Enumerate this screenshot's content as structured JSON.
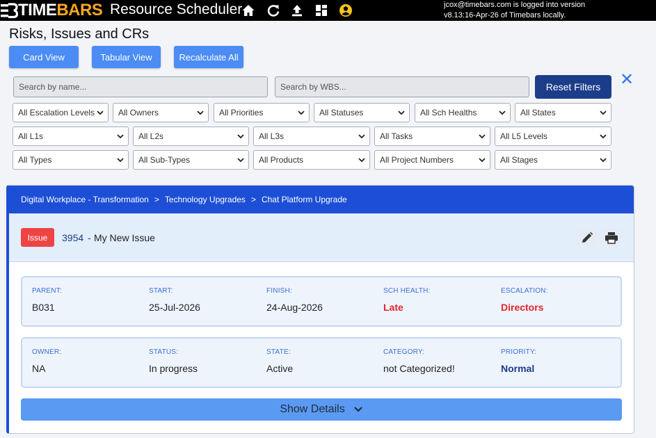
{
  "app": {
    "logo_time": "TIME",
    "logo_bars": "BARS",
    "name": "Resource Scheduler",
    "login_line1": "jcox@timebars.com is logged into version",
    "login_line2": "v8.13:16-Apr-26 of Timebars locally."
  },
  "nav_icons": [
    "home-icon",
    "refresh-icon",
    "upload-icon",
    "dashboard-icon",
    "user-icon"
  ],
  "page": {
    "title": "Risks, Issues and CRs"
  },
  "view_buttons": {
    "card": "Card View",
    "tabular": "Tabular View",
    "recalc": "Recalculate All"
  },
  "search": {
    "name_placeholder": "Search by name...",
    "wbs_placeholder": "Search by WBS...",
    "reset_label": "Reset Filters",
    "close_glyph": "✕"
  },
  "filters": {
    "row1": [
      "All Escalation Levels",
      "All Owners",
      "All Priorities",
      "All Statuses",
      "All Sch Healths",
      "All States"
    ],
    "row2": [
      "All L1s",
      "All L2s",
      "All L3s",
      "All Tasks",
      "All L5 Levels"
    ],
    "row3": [
      "All Types",
      "All Sub-Types",
      "All Products",
      "All Project Numbers",
      "All Stages"
    ]
  },
  "card": {
    "breadcrumb": [
      "Digital Workplace - Transformation",
      "Technology Upgrades",
      "Chat Platform Upgrade"
    ],
    "breadcrumb_sep": ">",
    "badge": "Issue",
    "id": "3954",
    "dash": "-",
    "title": "My New Issue",
    "row1": [
      {
        "label": "PARENT:",
        "value": "B031"
      },
      {
        "label": "START:",
        "value": "25-Jul-2026"
      },
      {
        "label": "FINISH:",
        "value": "24-Aug-2026"
      },
      {
        "label": "SCH HEALTH:",
        "value": "Late"
      },
      {
        "label": "ESCALATION:",
        "value": "Directors"
      }
    ],
    "row2": [
      {
        "label": "OWNER:",
        "value": "NA"
      },
      {
        "label": "STATUS:",
        "value": "In progress"
      },
      {
        "label": "STATE:",
        "value": "Active"
      },
      {
        "label": "CATEGORY:",
        "value": "not Categorized!"
      },
      {
        "label": "PRIORITY:",
        "value": "Normal"
      }
    ],
    "show_details": "Show Details"
  },
  "colors": {
    "accent": "#1d4fd6",
    "button": "#4b8cf5",
    "reset": "#1b3d8a",
    "badge": "#ef4444",
    "alert_text": "#e4232b"
  }
}
